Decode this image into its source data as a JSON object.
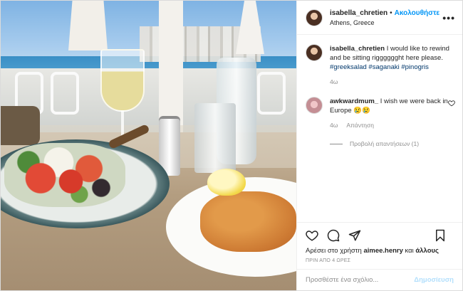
{
  "post": {
    "username": "isabella_chretien",
    "separator": "•",
    "follow_label": "Ακολουθήστε",
    "location": "Athens, Greece",
    "more_label": "•••"
  },
  "caption": {
    "username": "isabella_chretien",
    "text": " I would like to rewind and be sitting rigggggght here please. ",
    "tags": [
      "#greeksalad",
      "#saganaki",
      "#pinogris"
    ],
    "age": "4ω"
  },
  "comment": {
    "username": "awkwardmum_",
    "text": " I wish we were back in Europe 😢😢",
    "age": "4ω",
    "reply_label": "Απάντηση",
    "view_replies_label": "Προβολή απαντήσεων (1)"
  },
  "likes": {
    "prefix": "Αρέσει στο χρήστη ",
    "user": "aimee.henry",
    "suffix": " και ",
    "others": "άλλους"
  },
  "timestamp": "ΠΡΙΝ ΑΠΟ 4 ΩΡΕΣ",
  "add_comment": {
    "placeholder": "Προσθέστε ένα σχόλιο...",
    "post_label": "Δημοσίευση"
  },
  "colors": {
    "accent": "#0095f6",
    "hashtag": "#00376b",
    "muted": "#8e8e8e",
    "post_disabled": "#b2dffc"
  },
  "icons": [
    "like-heart-icon",
    "comment-icon",
    "share-icon",
    "save-bookmark-icon",
    "more-options-icon"
  ]
}
